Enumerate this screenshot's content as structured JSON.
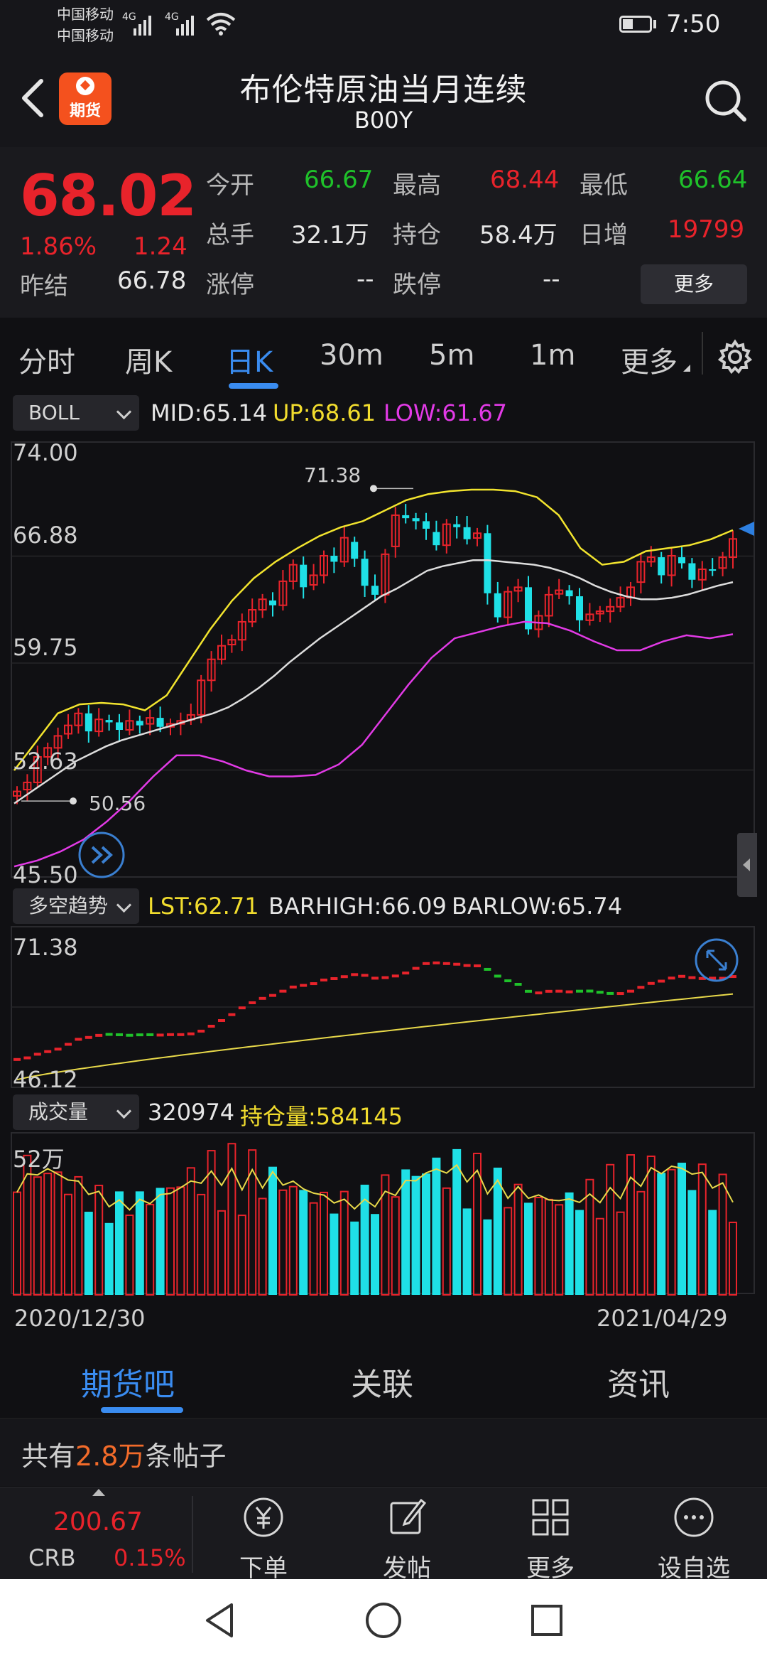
{
  "status_bar": {
    "carrier_1": "中国移动",
    "carrier_2": "中国移动",
    "network_1": "4G",
    "network_2": "4G",
    "time": "7:50"
  },
  "header": {
    "title": "布伦特原油当月连续",
    "code": "B00Y",
    "logo_text": "期货",
    "back_icon": "back-arrow-icon",
    "search_icon": "search-icon"
  },
  "quote": {
    "price": "68.02",
    "change_pct": "1.86%",
    "change": "1.24",
    "prev_settle_label": "昨结",
    "prev_settle": "66.78",
    "open_label": "今开",
    "open": "66.67",
    "high_label": "最高",
    "high": "68.44",
    "low_label": "最低",
    "low": "66.64",
    "volume_label": "总手",
    "volume": "32.1万",
    "open_interest_label": "持仓",
    "open_interest": "58.4万",
    "daily_increase_label": "日增",
    "daily_increase": "19799",
    "limit_up_label": "涨停",
    "limit_up": "--",
    "limit_down_label": "跌停",
    "limit_down": "--",
    "more_button": "更多"
  },
  "tabs": {
    "items": [
      "分时",
      "周K",
      "日K",
      "30m",
      "5m",
      "1m",
      "更多"
    ],
    "active": "日K",
    "settings_icon": "gear-icon"
  },
  "main_chart": {
    "indicator": "BOLL",
    "mid_label": "MID:65.14",
    "up_label": "UP:68.61",
    "low_label": "LOW:61.67",
    "y_ticks": [
      "74.00",
      "66.88",
      "59.75",
      "52.63",
      "45.50"
    ],
    "high_marker": "71.38",
    "low_marker": "50.56"
  },
  "trend_chart": {
    "indicator": "多空趋势",
    "lst_label": "LST:62.71",
    "barhigh_label": "BARHIGH:66.09",
    "barlow_label": "BARLOW:65.74",
    "y_top": "71.38",
    "y_bottom": "46.12"
  },
  "volume_chart": {
    "indicator": "成交量",
    "volume_value": "320974",
    "oi_label": "持仓量:584145",
    "y_top": "52万",
    "date_start": "2020/12/30",
    "date_end": "2021/04/29"
  },
  "colors": {
    "up": "#e8232b",
    "down": "#1fe0e6",
    "boll_mid": "#dddddd",
    "boll_up": "#f2e42e",
    "boll_low": "#e23ae6",
    "accent": "#3a8cf0"
  },
  "chart_data": {
    "type": "line",
    "title": "布伦特原油当月连续",
    "x_start": "2020/12/30",
    "x_end": "2021/04/29",
    "ylim": [
      45.5,
      74.0
    ],
    "close": [
      51.2,
      51.8,
      53.5,
      54.1,
      54.9,
      55.6,
      56.4,
      55.2,
      56.0,
      55.8,
      55.3,
      55.9,
      55.6,
      56.1,
      55.5,
      55.7,
      55.9,
      56.3,
      58.6,
      60.0,
      60.9,
      61.3,
      62.5,
      63.3,
      64.0,
      63.6,
      65.2,
      66.3,
      64.8,
      65.6,
      66.9,
      66.5,
      68.1,
      66.7,
      64.9,
      64.3,
      67.0,
      69.6,
      69.4,
      69.2,
      68.7,
      67.6,
      69.0,
      68.8,
      68.0,
      68.4,
      64.4,
      62.8,
      64.5,
      64.8,
      62.0,
      62.9,
      64.3,
      64.6,
      64.2,
      62.6,
      63.0,
      63.2,
      63.5,
      64.1,
      64.8,
      66.5,
      66.8,
      65.6,
      66.9,
      66.4,
      65.3,
      66.0,
      65.9,
      66.8,
      68.02
    ],
    "series": [
      {
        "name": "MID",
        "values": [
          50.4,
          51.1,
          51.8,
          52.5,
          53.2,
          53.7,
          54.2,
          54.6,
          54.9,
          55.2,
          55.5,
          55.8,
          56.1,
          56.4,
          56.8,
          57.4,
          58.1,
          58.9,
          59.8,
          60.6,
          61.4,
          62.1,
          62.8,
          63.5,
          64.2,
          64.7,
          65.3,
          65.9,
          66.2,
          66.4,
          66.6,
          66.6,
          66.5,
          66.4,
          66.3,
          66.1,
          65.8,
          65.4,
          64.9,
          64.5,
          64.2,
          64.0,
          64.0,
          64.1,
          64.3,
          64.6,
          64.9,
          65.14
        ]
      },
      {
        "name": "UP",
        "values": [
          52.6,
          54.5,
          56.4,
          57.0,
          57.1,
          57.0,
          56.6,
          57.6,
          59.8,
          62.0,
          63.9,
          65.4,
          66.5,
          67.4,
          68.2,
          68.8,
          69.2,
          69.9,
          70.6,
          71.0,
          71.2,
          71.3,
          71.3,
          71.2,
          70.8,
          69.6,
          67.4,
          66.3,
          66.5,
          67.2,
          67.4,
          67.6,
          68.0,
          68.61
        ]
      },
      {
        "name": "LOW",
        "values": [
          46.2,
          46.6,
          47.2,
          48.0,
          49.2,
          50.6,
          52.2,
          53.6,
          53.6,
          53.2,
          52.6,
          52.2,
          52.2,
          52.3,
          53.0,
          54.3,
          56.3,
          58.3,
          60.1,
          61.4,
          61.8,
          62.2,
          62.5,
          62.4,
          61.9,
          61.2,
          60.6,
          60.6,
          61.2,
          61.6,
          61.4,
          61.67
        ]
      }
    ]
  }
}
